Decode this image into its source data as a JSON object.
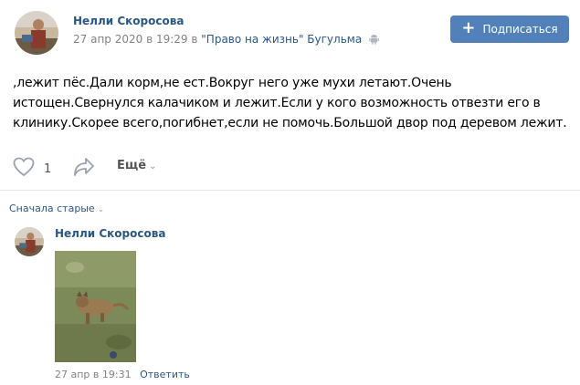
{
  "post": {
    "author": "Нелли Скоросова",
    "date": "27 апр 2020 в 19:29",
    "in_word": "в",
    "group": "\"Право на жизнь\" Бугульма",
    "platform_icon": "android-icon",
    "subscribe_label": "Подписаться",
    "text": ",лежит пёс.Дали корм,не ест.Вокруг него уже мухи летают.Очень истощен.Свернулся калачиком и лежит.Если у кого возможность отвезти его в клинику.Скорее всего,погибнет,если не помочь.Большой двор под деревом лежит."
  },
  "actions": {
    "like_icon": "heart-icon",
    "likes": "1",
    "share_icon": "share-arrow-icon",
    "more_label": "Ещё"
  },
  "comments": {
    "sort_label": "Сначала старые",
    "items": [
      {
        "author": "Нелли Скоросова",
        "date": "27 апр в 19:31",
        "reply_label": "Ответить"
      }
    ]
  },
  "colors": {
    "link": "#2a5885",
    "button": "#5181b8",
    "meta": "#828282",
    "divider": "#e7e8ec"
  }
}
